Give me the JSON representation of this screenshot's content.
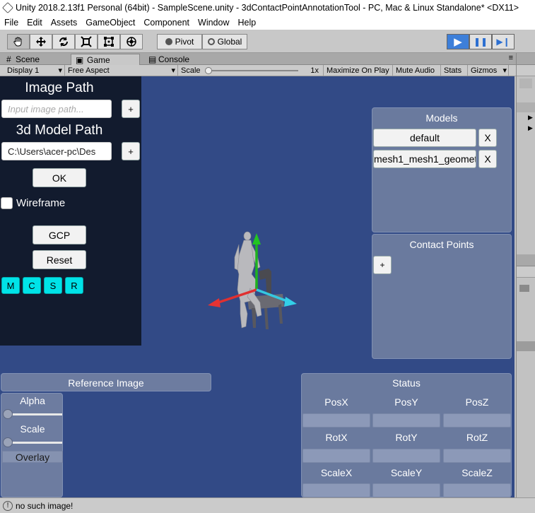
{
  "window": {
    "title": "Unity 2018.2.13f1 Personal (64bit) - SampleScene.unity - 3dContactPointAnnotationTool - PC, Mac & Linux Standalone* <DX11>"
  },
  "menu": [
    "File",
    "Edit",
    "Assets",
    "GameObject",
    "Component",
    "Window",
    "Help"
  ],
  "toolbar": {
    "pivot_label": "Pivot",
    "global_label": "Global",
    "play_glyph": "▶",
    "pause_glyph": "❚❚",
    "step_glyph": "▶❙"
  },
  "tabs": [
    {
      "label": "Scene",
      "icon": "#"
    },
    {
      "label": "Game",
      "icon": "▣"
    },
    {
      "label": "Console",
      "icon": "▤"
    }
  ],
  "game_toolbar": {
    "display": "Display 1",
    "aspect": "Free Aspect",
    "scale_label": "Scale",
    "scale_value": "1x",
    "maximize": "Maximize On Play",
    "mute": "Mute Audio",
    "stats": "Stats",
    "gizmos": "Gizmos"
  },
  "left_panel": {
    "image_path_title": "Image Path",
    "image_path_placeholder": "Input image path...",
    "image_add": "+",
    "model_path_title": "3d Model Path",
    "model_path_value": "C:\\Users\\acer-pc\\Des",
    "model_add": "+",
    "ok": "OK",
    "wireframe": "Wireframe",
    "gcp": "GCP",
    "reset": "Reset",
    "mode_buttons": [
      "M",
      "C",
      "S",
      "R"
    ]
  },
  "models_panel": {
    "title": "Models",
    "items": [
      {
        "name": "default",
        "remove": "X"
      },
      {
        "name": "mesh1_mesh1_geomet",
        "remove": "X"
      }
    ]
  },
  "contact_points_panel": {
    "title": "Contact Points",
    "add": "+"
  },
  "reference_panel": {
    "title": "Reference Image",
    "alpha": "Alpha",
    "scale": "Scale",
    "overlay": "Overlay",
    "alpha_value": 0,
    "scale_value": 0
  },
  "status_panel": {
    "title": "Status",
    "rows": [
      [
        "PosX",
        "PosY",
        "PosZ"
      ],
      [
        "RotX",
        "RotY",
        "RotZ"
      ],
      [
        "ScaleX",
        "ScaleY",
        "ScaleZ"
      ]
    ]
  },
  "statusbar": {
    "message": "no such image!"
  },
  "colors": {
    "game_bg": "#324a86",
    "left_panel_bg": "#121b2e",
    "cyan": "#00e3e8",
    "play_active": "#3d7fd9"
  }
}
